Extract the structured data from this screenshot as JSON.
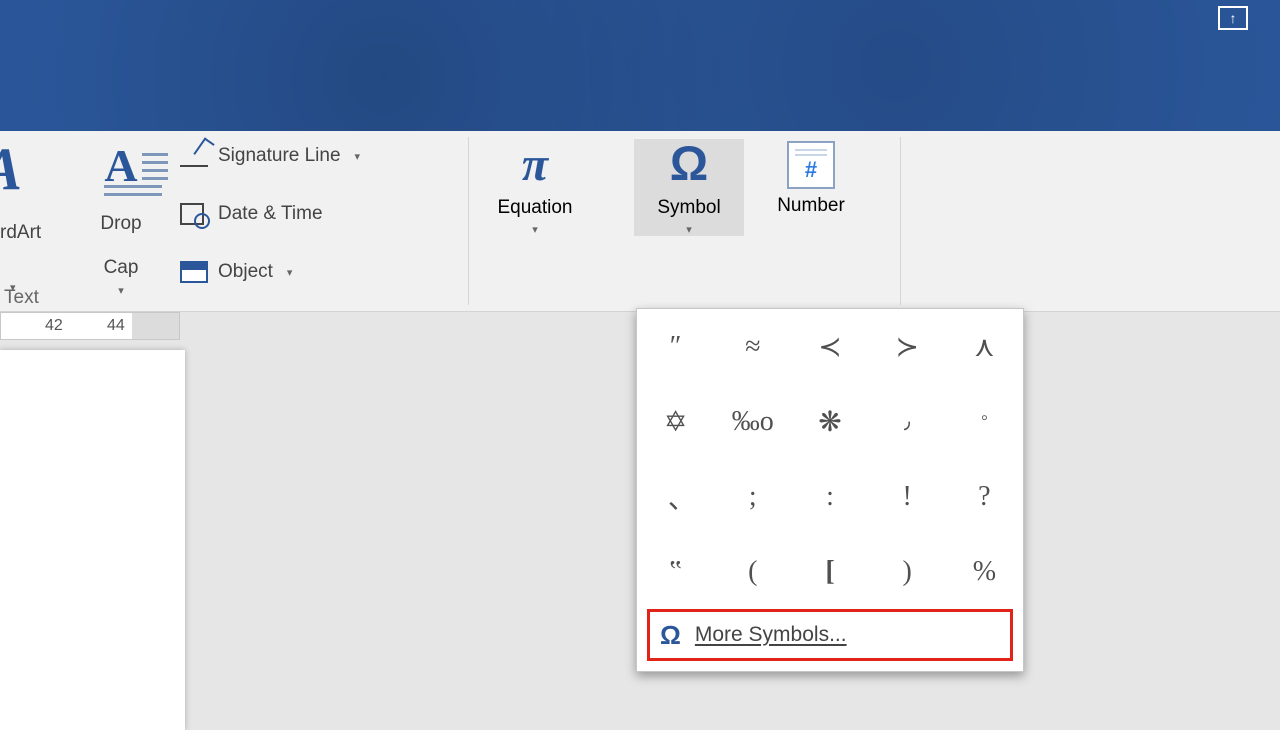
{
  "banner": {
    "corner_icon": "presentation-icon"
  },
  "ribbon": {
    "text_group": {
      "label": "Text",
      "wordart_label": "rdArt",
      "dropcap_label_l1": "Drop",
      "dropcap_label_l2": "Cap",
      "signature_label": "Signature Line",
      "datetime_label": "Date & Time",
      "object_label": "Object"
    },
    "symbols_group": {
      "equation_label": "Equation",
      "symbol_label": "Symbol",
      "number_label": "Number",
      "equation_glyph": "π",
      "symbol_glyph": "Ω",
      "number_glyph": "#"
    }
  },
  "ruler": {
    "n1": "42",
    "n2": "44"
  },
  "symbol_panel": {
    "cells": [
      "″",
      "≈",
      "≺",
      "≻",
      "⋏",
      "✡",
      "‰o",
      "❋",
      "٫",
      "°",
      "､",
      ";",
      ":",
      "!",
      "?",
      "‟",
      "(",
      "[",
      ")",
      "%"
    ],
    "more_glyph": "Ω",
    "more_label": "More Symbols..."
  }
}
